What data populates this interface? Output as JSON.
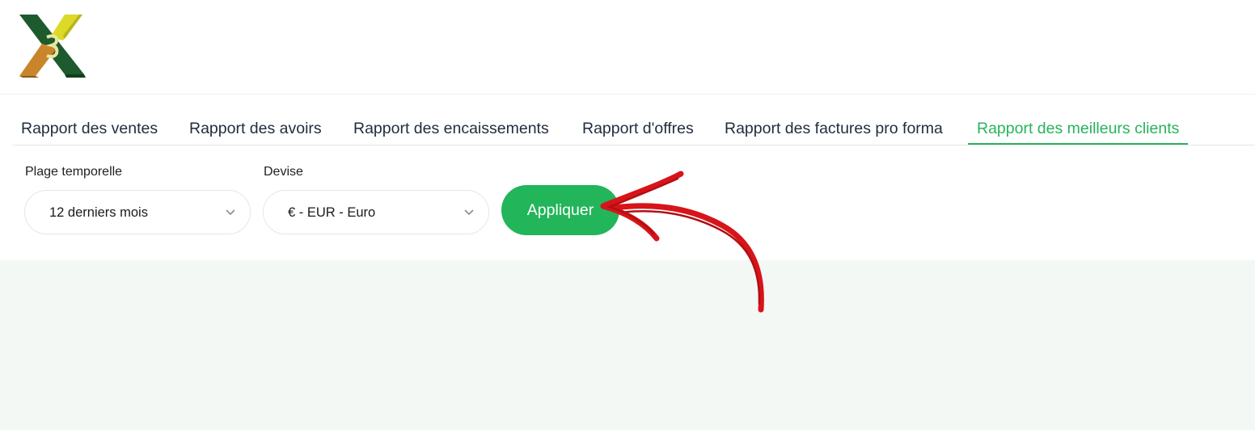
{
  "tabs": [
    {
      "label": "Rapport des ventes",
      "active": false
    },
    {
      "label": "Rapport des avoirs",
      "active": false
    },
    {
      "label": "Rapport des encaissements",
      "active": false
    },
    {
      "label": "Rapport d'offres",
      "active": false
    },
    {
      "label": "Rapport des factures pro forma",
      "active": false
    },
    {
      "label": "Rapport des meilleurs clients",
      "active": true
    }
  ],
  "filters": {
    "time_range": {
      "label": "Plage temporelle",
      "value": "12 derniers mois"
    },
    "currency": {
      "label": "Devise",
      "value": "€ - EUR - Euro"
    },
    "apply_label": "Appliquer"
  },
  "icons": {
    "logo": "x3-logo-icon",
    "select_chevron": "chevron-down-icon",
    "annotation": "red-arrow-annotation"
  },
  "colors": {
    "accent": "#22b55a",
    "tab_text": "#1f2d3d",
    "content_bg": "#f3f8f4",
    "annotation": "#d7141a"
  }
}
